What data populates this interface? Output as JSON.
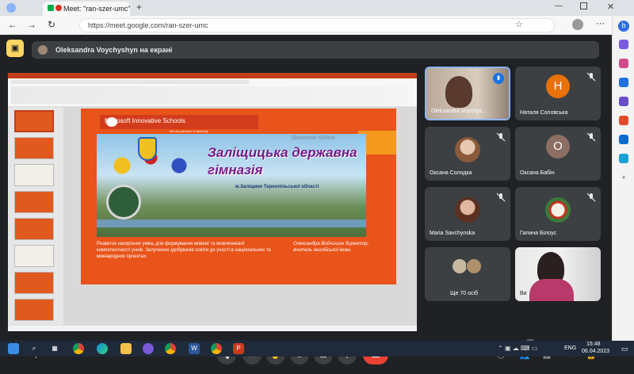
{
  "browser": {
    "tab_title": "Meet: \"ran-szer-umc\"",
    "url": "https://meet.google.com/ran-szer-umc"
  },
  "meet": {
    "presenting_banner": "Oleksandra Voychyshyn на екрані",
    "participants": [
      {
        "name": "Oleksandra Voychys...",
        "type": "video"
      },
      {
        "name": "Наталя Соловська",
        "initial": "Н",
        "color": "#e8710a"
      },
      {
        "name": "Оксана Солодка",
        "type": "photo"
      },
      {
        "name": "Оксана Бабін",
        "initial": "О",
        "color": "#8d6e63"
      },
      {
        "name": "Maria Savchynska",
        "type": "photo"
      },
      {
        "name": "Галина Білоус",
        "type": "photo"
      },
      {
        "name": "Ще 70 осіб",
        "type": "group"
      },
      {
        "name": "Ви",
        "type": "video"
      }
    ],
    "time": "15:48",
    "meeting_code": "ran-szer-umc",
    "participant_count": "78"
  },
  "slide": {
    "mis_title": "Microsoft Innovative Schools",
    "mis_tag": "We are partners in learning",
    "showcase": "Showcase School",
    "school_line1": "Заліщицька державна",
    "school_line2": "гімназія",
    "town": "м.Заліщики  Тернопільської області",
    "left_text": "Розвиток наскрізних умінь для формування мовної та мовленнєвої компетентності учнів. Залучення здобувачів освіти до участі в національних та міжнародних проєктах.",
    "right_text": "Олександра Войчишин директор, вчитель англійської мови"
  },
  "taskbar": {
    "time": "15:48",
    "date": "06.04.2023",
    "lang": "ENG"
  }
}
